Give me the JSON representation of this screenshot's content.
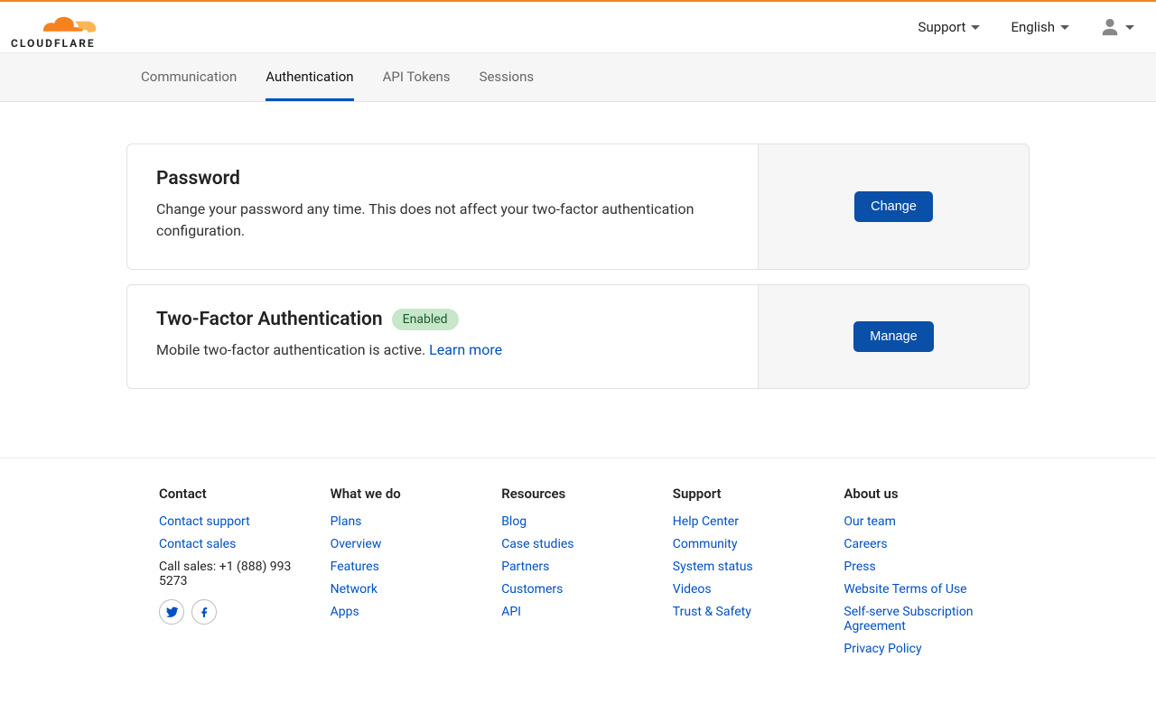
{
  "brand": {
    "name": "CLOUDFLARE"
  },
  "header": {
    "support": "Support",
    "language": "English"
  },
  "tabs": {
    "items": [
      {
        "label": "Communication"
      },
      {
        "label": "Authentication"
      },
      {
        "label": "API Tokens"
      },
      {
        "label": "Sessions"
      }
    ],
    "active_index": 1
  },
  "password_card": {
    "title": "Password",
    "desc": "Change your password any time. This does not affect your two-factor authentication configuration.",
    "button": "Change"
  },
  "tfa_card": {
    "title": "Two-Factor Authentication",
    "badge": "Enabled",
    "desc": "Mobile two-factor authentication is active.",
    "learn_more": "Learn more",
    "button": "Manage"
  },
  "footer": {
    "contact": {
      "heading": "Contact",
      "support": "Contact support",
      "sales": "Contact sales",
      "call": "Call sales: +1 (888) 993 5273"
    },
    "whatwedo": {
      "heading": "What we do",
      "items": [
        "Plans",
        "Overview",
        "Features",
        "Network",
        "Apps"
      ]
    },
    "resources": {
      "heading": "Resources",
      "items": [
        "Blog",
        "Case studies",
        "Partners",
        "Customers",
        "API"
      ]
    },
    "support": {
      "heading": "Support",
      "items": [
        "Help Center",
        "Community",
        "System status",
        "Videos",
        "Trust & Safety"
      ]
    },
    "about": {
      "heading": "About us",
      "items": [
        "Our team",
        "Careers",
        "Press",
        "Website Terms of Use",
        "Self-serve Subscription Agreement",
        "Privacy Policy"
      ]
    }
  }
}
